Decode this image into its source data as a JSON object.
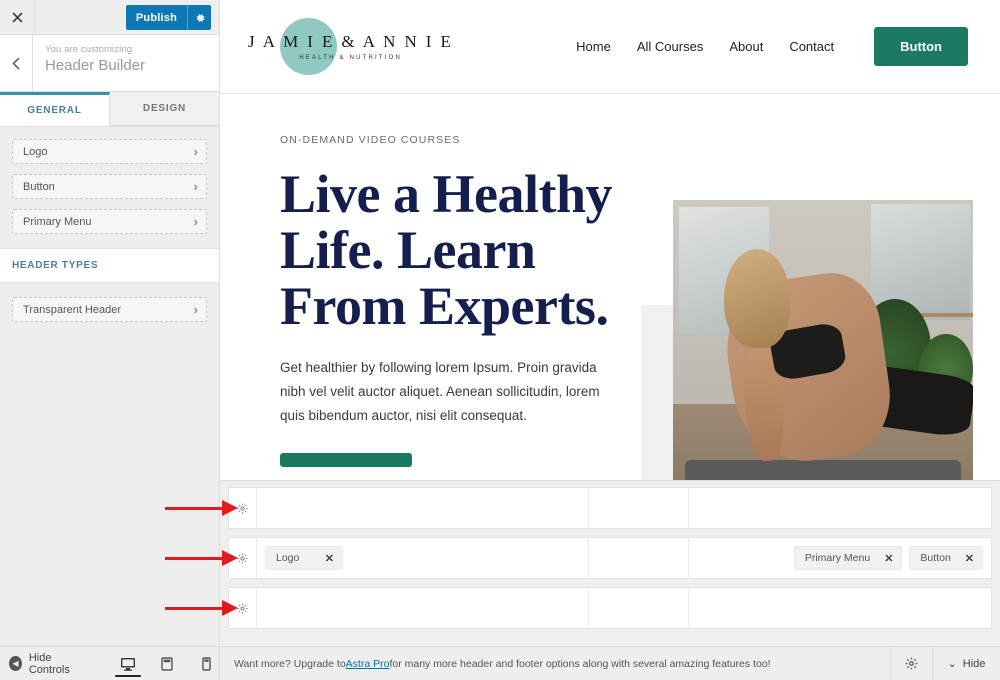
{
  "customizer": {
    "close_label": "✕",
    "publish_label": "Publish",
    "publish_gear_icon": "gear-icon",
    "back_icon": "chevron-left-icon",
    "kicker": "You are customizing",
    "title": "Header Builder",
    "tabs": [
      {
        "label": "GENERAL",
        "active": true
      },
      {
        "label": "DESIGN",
        "active": false
      }
    ],
    "items": [
      {
        "label": "Logo"
      },
      {
        "label": "Button"
      },
      {
        "label": "Primary Menu"
      }
    ],
    "section_title": "HEADER TYPES",
    "section_items": [
      {
        "label": "Transparent Header"
      }
    ],
    "accent_blue": "#0e78b4",
    "accent_teal": "#4a7f94"
  },
  "site": {
    "logo": {
      "main": "J A M I E   &   A N N I E",
      "sub": "HEALTH & NUTRITION",
      "circle_color": "#8fc9c2"
    },
    "nav": [
      {
        "label": "Home"
      },
      {
        "label": "All Courses"
      },
      {
        "label": "About"
      },
      {
        "label": "Contact"
      }
    ],
    "nav_button": "Button",
    "nav_button_color": "#1c7a63",
    "hero": {
      "kicker": "ON-DEMAND VIDEO COURSES",
      "title": "Live a Healthy Life. Learn From Experts.",
      "body": "Get healthier by following lorem Ipsum. Proin gravida nibh vel velit auctor aliquet. Aenean sollicitudin, lorem quis bibendum auctor, nisi elit consequat.",
      "title_color": "#151f4d"
    }
  },
  "builder": {
    "rows": [
      {
        "name": "above-header-row",
        "gear_icon": "gear-icon",
        "left": [],
        "center": [],
        "right": []
      },
      {
        "name": "primary-header-row",
        "gear_icon": "gear-icon",
        "left": [
          {
            "label": "Logo",
            "remove": "✕"
          }
        ],
        "center": [],
        "right": [
          {
            "label": "Primary Menu",
            "remove": "✕"
          },
          {
            "label": "Button",
            "remove": "✕"
          }
        ]
      },
      {
        "name": "below-header-row",
        "gear_icon": "gear-icon",
        "left": [],
        "center": [],
        "right": []
      }
    ],
    "annotation_arrow_color": "#e01b1b"
  },
  "footer": {
    "hide_controls_label": "Hide Controls",
    "devices": [
      {
        "name": "desktop",
        "active": true
      },
      {
        "name": "tablet",
        "active": false
      },
      {
        "name": "mobile",
        "active": false
      }
    ],
    "upgrade_prefix": "Want more? Upgrade to ",
    "upgrade_link": "Astra Pro",
    "upgrade_suffix": " for many more header and footer options along with several amazing features too!",
    "gear_icon": "gear-icon",
    "hide_label": "Hide",
    "hide_chevron": "⌄"
  }
}
